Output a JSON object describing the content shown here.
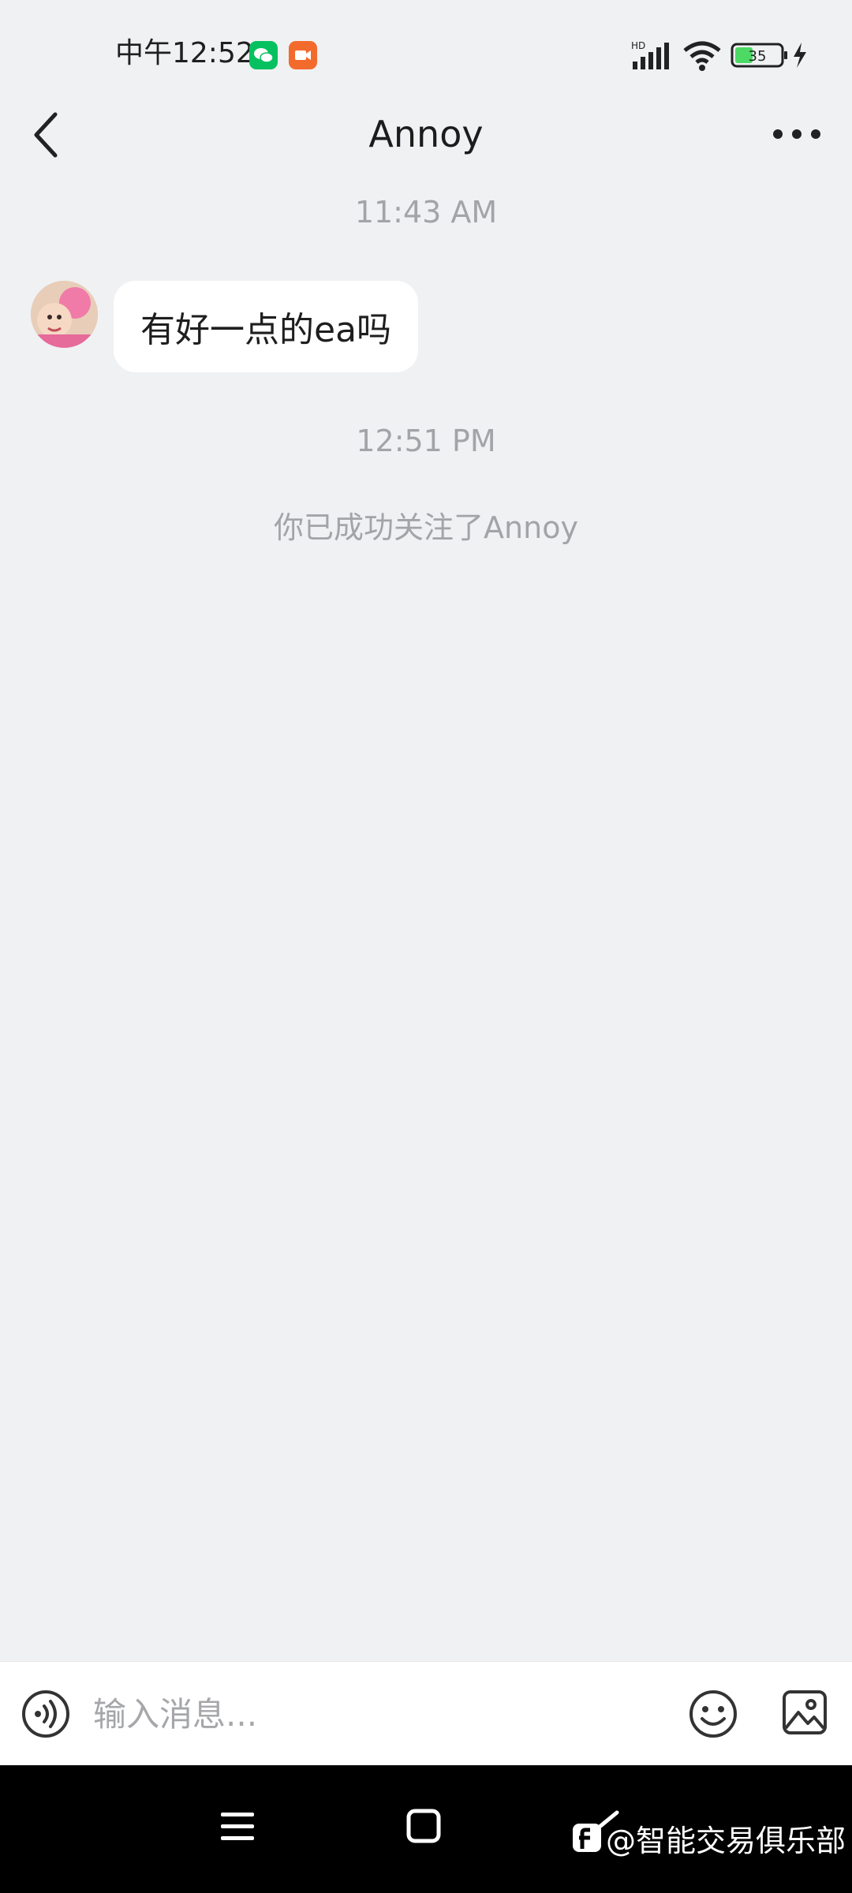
{
  "status_bar": {
    "time": "中午12:52",
    "network_label": "HD",
    "battery_level": "35"
  },
  "header": {
    "title": "Annoy"
  },
  "chat": {
    "messages": [
      {
        "timestamp": "11:43 AM",
        "text": "有好一点的ea吗"
      }
    ],
    "second_timestamp": "12:51 PM",
    "system_note": "你已成功关注了Annoy"
  },
  "input_bar": {
    "placeholder": "输入消息..."
  },
  "watermark": {
    "text": "@智能交易俱乐部"
  },
  "colors": {
    "background": "#f0f1f3",
    "wechat_badge": "#07c160",
    "video_badge": "#f36b2c",
    "battery_green": "#4cd964"
  },
  "icons": [
    "back-icon",
    "more-icon",
    "voice-icon",
    "emoji-icon",
    "image-icon",
    "menu-icon",
    "home-icon",
    "nav-back-icon"
  ]
}
